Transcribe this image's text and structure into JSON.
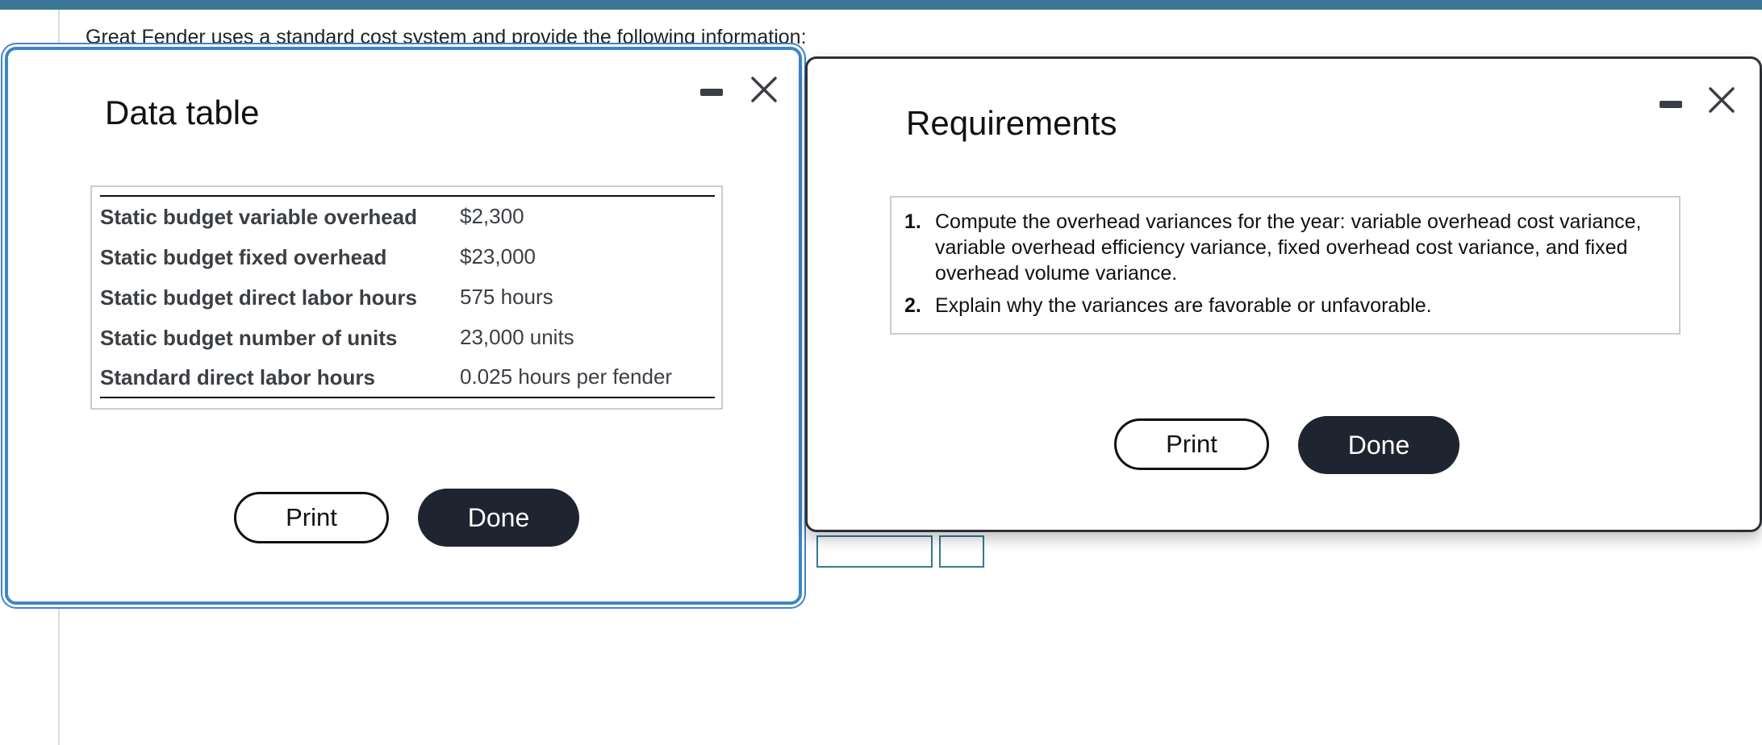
{
  "background": {
    "intro_text": "Great Fender uses a standard cost system and provide the following information:"
  },
  "data_dialog": {
    "title": "Data table",
    "minimize_icon": "minimize-icon",
    "close_icon": "close-icon",
    "rows": [
      {
        "label": "Static budget variable overhead",
        "value": "$2,300"
      },
      {
        "label": "Static budget fixed overhead",
        "value": "$23,000"
      },
      {
        "label": "Static budget direct labor hours",
        "value": "575 hours"
      },
      {
        "label": "Static budget number of units",
        "value": "23,000 units"
      },
      {
        "label": "Standard direct labor hours",
        "value": "0.025 hours per fender"
      }
    ],
    "print_label": "Print",
    "done_label": "Done"
  },
  "requirements_dialog": {
    "title": "Requirements",
    "minimize_icon": "minimize-icon",
    "close_icon": "close-icon",
    "items": [
      {
        "number": "1.",
        "text": "Compute the overhead variances for the year: variable overhead cost variance, variable overhead efficiency variance, fixed overhead cost variance, and fixed overhead volume variance."
      },
      {
        "number": "2.",
        "text": "Explain why the variances are favorable or unfavorable."
      }
    ],
    "print_label": "Print",
    "done_label": "Done"
  },
  "colors": {
    "top_bar": "#3a7795",
    "active_dialog_border": "#3d86c6",
    "done_button": "#1f2530"
  }
}
